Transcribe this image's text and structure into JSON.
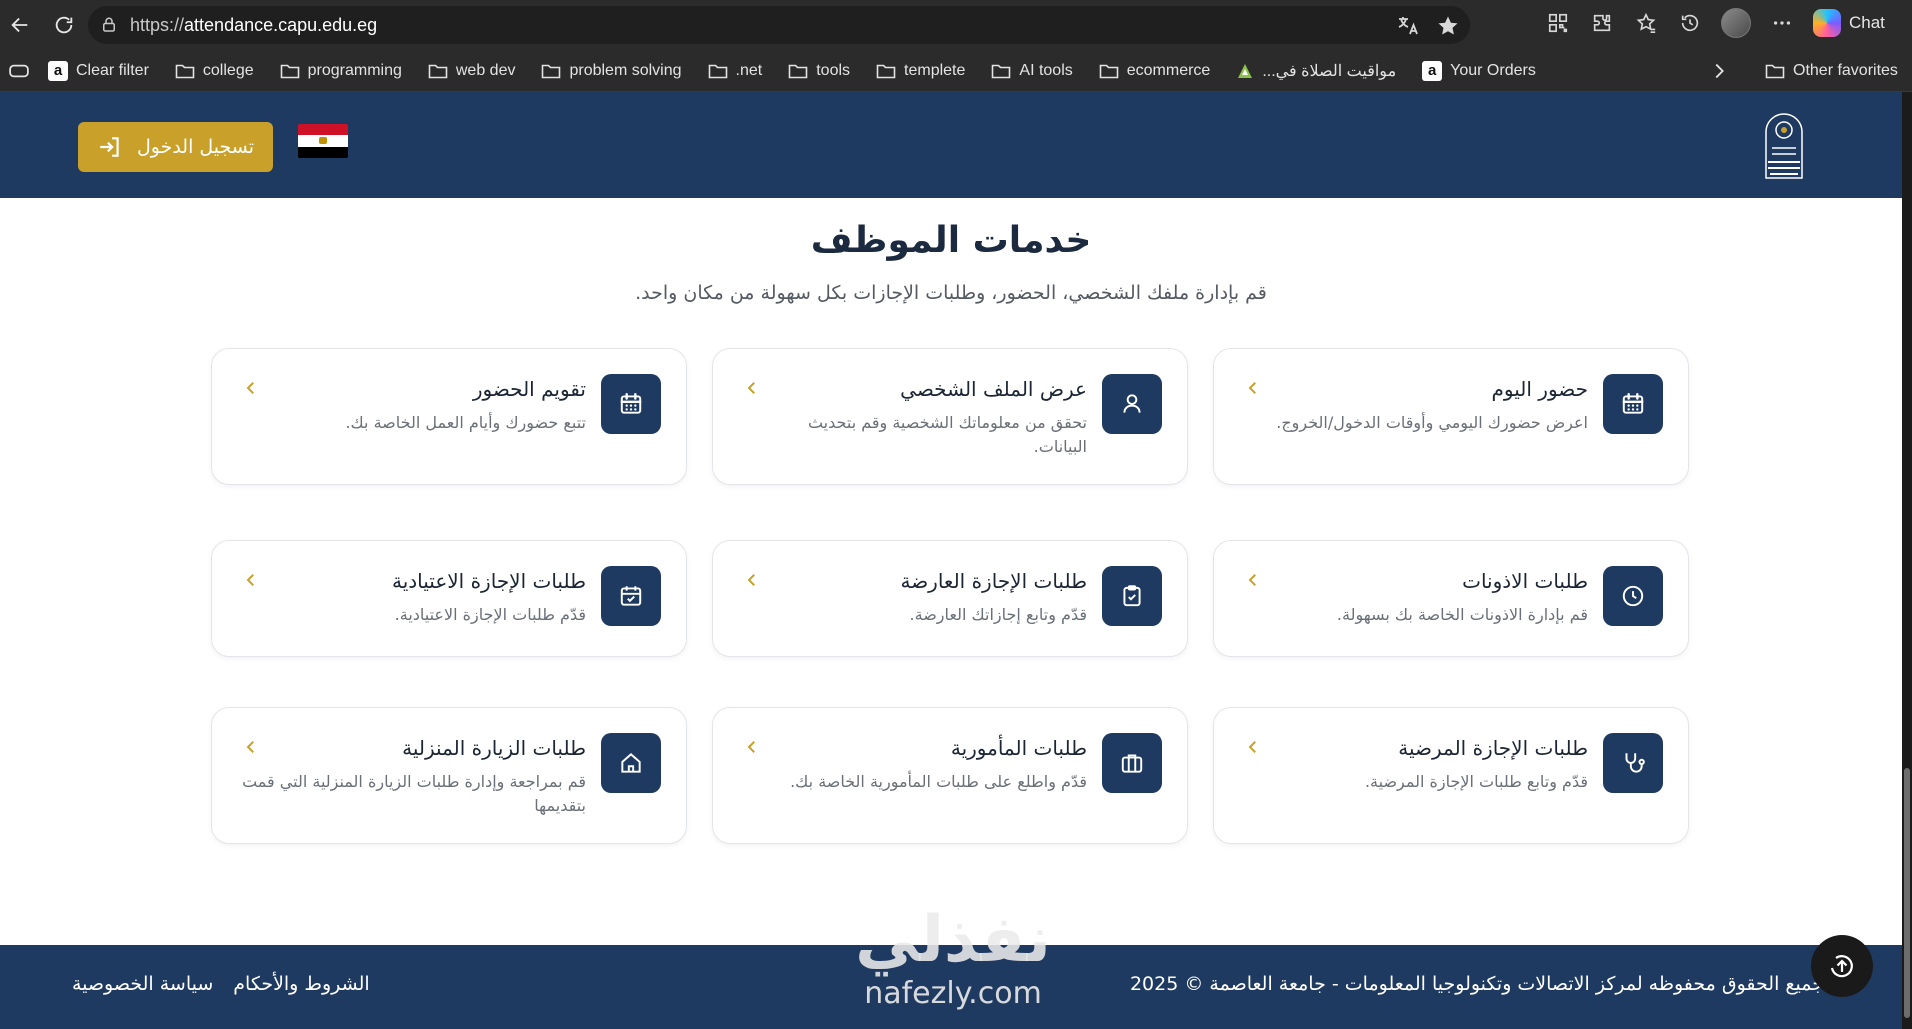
{
  "browser": {
    "url_scheme": "https://",
    "url_host": "attendance.capu.edu.eg",
    "copilot_label": "Chat"
  },
  "bookmarks": [
    {
      "label": "Clear filter",
      "icon": "amazon-icon"
    },
    {
      "label": "college",
      "icon": "folder-icon"
    },
    {
      "label": "programming",
      "icon": "folder-icon"
    },
    {
      "label": "web dev",
      "icon": "folder-icon"
    },
    {
      "label": "problem solving",
      "icon": "folder-icon"
    },
    {
      "label": ".net",
      "icon": "folder-icon"
    },
    {
      "label": "tools",
      "icon": "folder-icon"
    },
    {
      "label": "templete",
      "icon": "folder-icon"
    },
    {
      "label": "AI tools",
      "icon": "folder-icon"
    },
    {
      "label": "ecommerce",
      "icon": "folder-icon"
    },
    {
      "label": "مواقيت الصلاة في...",
      "icon": "prayer-icon"
    },
    {
      "label": "Your Orders",
      "icon": "amazon-icon"
    }
  ],
  "other_favorites": "Other favorites",
  "header": {
    "login_label": "تسجيل الدخول"
  },
  "section": {
    "title": "خدمات الموظف",
    "subtitle": "قم بإدارة ملفك الشخصي، الحضور، وطلبات الإجازات بكل سهولة من مكان واحد."
  },
  "cards": [
    {
      "title": "حضور اليوم",
      "desc": "اعرض حضورك اليومي وأوقات الدخول/الخروج.",
      "icon": "calendar-icon"
    },
    {
      "title": "عرض الملف الشخصي",
      "desc": "تحقق من معلوماتك الشخصية وقم بتحديث البيانات.",
      "icon": "user-icon"
    },
    {
      "title": "تقويم الحضور",
      "desc": "تتبع حضورك وأيام العمل الخاصة بك.",
      "icon": "calendar-icon"
    },
    {
      "title": "طلبات الاذونات",
      "desc": "قم بإدارة الاذونات الخاصة بك بسهولة.",
      "icon": "clock-icon"
    },
    {
      "title": "طلبات الإجازة العارضة",
      "desc": "قدّم وتابع إجازاتك العارضة.",
      "icon": "clipboard-check-icon"
    },
    {
      "title": "طلبات الإجازة الاعتيادية",
      "desc": "قدّم طلبات الإجازة الاعتيادية.",
      "icon": "calendar-check-icon"
    },
    {
      "title": "طلبات الإجازة المرضية",
      "desc": "قدّم وتابع طلبات الإجازة المرضية.",
      "icon": "stethoscope-icon"
    },
    {
      "title": "طلبات المأمورية",
      "desc": "قدّم واطلع على طلبات المأمورية الخاصة بك.",
      "icon": "briefcase-icon"
    },
    {
      "title": "طلبات الزيارة المنزلية",
      "desc": "قم بمراجعة وإدارة طلبات الزيارة المنزلية التي قمت بتقديمها",
      "icon": "home-icon"
    }
  ],
  "footer": {
    "copyright": "جميع الحقوق محفوظه لمركز الاتصالات وتكنولوجيا المعلومات - جامعة العاصمة © 2025",
    "terms": "الشروط والأحكام",
    "privacy": "سياسة الخصوصية"
  },
  "watermark": {
    "ar": "نفذلي",
    "en": "nafezly.com"
  },
  "colors": {
    "navy": "#1f3a60",
    "gold": "#c9a02a"
  }
}
